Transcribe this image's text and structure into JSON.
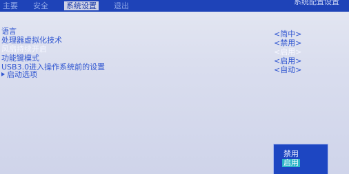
{
  "menubar": {
    "tabs": [
      {
        "label": "主要"
      },
      {
        "label": "安全"
      },
      {
        "label": "系统设置"
      },
      {
        "label": "退出"
      }
    ],
    "sysinfo": "系统配置设置"
  },
  "settings": {
    "items": [
      {
        "label": "语言",
        "value": "<简中>"
      },
      {
        "label": "处理器虚拟化技术",
        "value": "<禁用>"
      },
      {
        "label": "风扇持续开启",
        "value": "<启用>"
      },
      {
        "label": "功能键模式",
        "value": "<启用>"
      },
      {
        "label": "USB3.0进入操作系统前的设置",
        "value": "<自动>"
      },
      {
        "label": "启动选项"
      }
    ]
  },
  "popup": {
    "options": [
      {
        "label": "禁用"
      },
      {
        "label": "启用"
      }
    ],
    "selected": "启用"
  }
}
